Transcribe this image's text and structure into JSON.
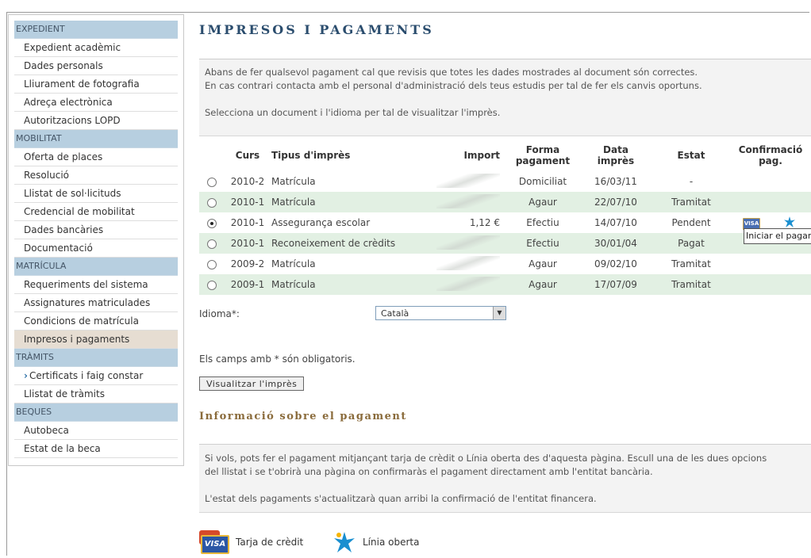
{
  "sidebar": {
    "sections": [
      {
        "title": "EXPEDIENT",
        "items": [
          "Expedient acadèmic",
          "Dades personals",
          "Lliurament de fotografia",
          "Adreça electrònica",
          "Autoritzacions LOPD"
        ]
      },
      {
        "title": "MOBILITAT",
        "items": [
          "Oferta de places",
          "Resolució",
          "Llistat de sol·licituds",
          "Credencial de mobilitat",
          "Dades bancàries",
          "Documentació"
        ]
      },
      {
        "title": "MATRÍCULA",
        "items": [
          "Requeriments del sistema",
          "Assignatures matriculades",
          "Condicions de matrícula",
          "Impresos i pagaments"
        ]
      },
      {
        "title": "TRÀMITS",
        "items": [
          "Certificats i faig constar",
          "Llistat de tràmits"
        ]
      },
      {
        "title": "BEQUES",
        "items": [
          "Autobeca",
          "Estat de la beca"
        ]
      }
    ],
    "active_item": "Impresos i pagaments"
  },
  "page": {
    "title": "IMPRESOS I PAGAMENTS",
    "intro_line1": "Abans de fer qualsevol pagament cal que revisis que totes les dades mostrades al document són correctes.",
    "intro_line2": "En cas contrari contacta amb el personal d'administració dels teus estudis per tal de fer els canvis oportuns.",
    "intro_line3": "Selecciona un document i l'idioma per tal de visualitzar l'imprès."
  },
  "table": {
    "headers": {
      "curs": "Curs",
      "tipus": "Tipus d'imprès",
      "import": "Import",
      "forma1": "Forma",
      "forma2": "pagament",
      "data1": "Data",
      "data2": "imprès",
      "estat": "Estat",
      "conf1": "Confirmació",
      "conf2": "pag."
    },
    "rows": [
      {
        "selected": false,
        "curs": "2010-2",
        "tipus": "Matrícula",
        "import": "",
        "forma": "Domiciliat",
        "data": "16/03/11",
        "estat": "-"
      },
      {
        "selected": false,
        "curs": "2010-1",
        "tipus": "Matrícula",
        "import": "",
        "forma": "Agaur",
        "data": "22/07/10",
        "estat": "Tramitat"
      },
      {
        "selected": true,
        "curs": "2010-1",
        "tipus": "Assegurança escolar",
        "import": "1,12 €",
        "forma": "Efectiu",
        "data": "14/07/10",
        "estat": "Pendent"
      },
      {
        "selected": false,
        "curs": "2010-1",
        "tipus": "Reconeixement de crèdits",
        "import": "",
        "forma": "Efectiu",
        "data": "30/01/04",
        "estat": "Pagat"
      },
      {
        "selected": false,
        "curs": "2009-2",
        "tipus": "Matrícula",
        "import": "",
        "forma": "Agaur",
        "data": "09/02/10",
        "estat": "Tramitat"
      },
      {
        "selected": false,
        "curs": "2009-1",
        "tipus": "Matrícula",
        "import": "",
        "forma": "Agaur",
        "data": "17/07/09",
        "estat": "Tramitat"
      }
    ],
    "tooltip": "Iniciar el pagam"
  },
  "form": {
    "idioma_label": "Idioma*:",
    "idioma_value": "Català",
    "required_note": "Els camps amb * són obligatoris.",
    "view_button": "Visualitzar l'imprès"
  },
  "payment_info": {
    "title": "Informació sobre el pagament",
    "line1": "Si vols, pots fer el pagament mitjançant tarja de crèdit o Línia oberta des d'aquesta pàgina. Escull una de les dues opcions",
    "line2": "del llistat i se t'obrirà una pàgina on confirmaràs el pagament directament amb l'entitat bancària.",
    "line3": "L'estat dels pagaments s'actualitzarà quan arribi la confirmació de l'entitat financera.",
    "option_card": "Tarja de crèdit",
    "option_linia": "Línia oberta",
    "card_logo_text": "VISA"
  },
  "colors": {
    "section_bg": "#b7cfe0",
    "active_bg": "#e6ddd2",
    "row_alt": "#e2f0e3",
    "title": "#2b4d6e",
    "subtitle": "#8a6b3b"
  }
}
